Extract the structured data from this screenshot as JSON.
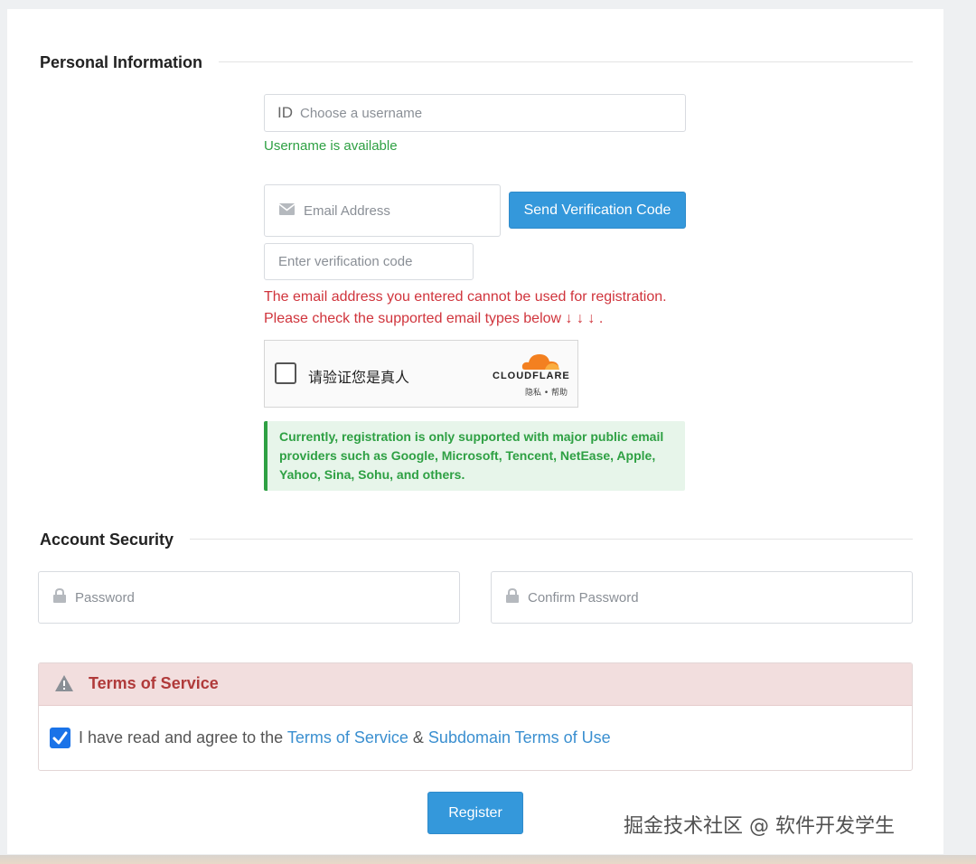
{
  "sections": {
    "personal": "Personal Information",
    "security": "Account Security"
  },
  "username": {
    "prefix": "ID",
    "placeholder": "Choose a username",
    "status": "Username is available"
  },
  "email": {
    "placeholder": "Email Address",
    "icon": "envelope-icon",
    "send_button": "Send Verification Code",
    "code_placeholder": "Enter verification code",
    "error_line1": "The email address you entered cannot be used for registration.",
    "error_line2": "Please check the supported email types below ↓ ↓ ↓ ."
  },
  "captcha": {
    "label": "请验证您是真人",
    "brand": "CLOUDFLARE",
    "links": "隐私 • 帮助"
  },
  "notice": "Currently, registration is only supported with major public email providers such as Google, Microsoft, Tencent, NetEase, Apple, Yahoo, Sina, Sohu, and others.",
  "password": {
    "placeholder": "Password",
    "confirm_placeholder": "Confirm Password",
    "icon": "lock-icon"
  },
  "terms": {
    "title": "Terms of Service",
    "agree_text": "I have read and agree to the ",
    "link1": "Terms of Service",
    "amp": " & ",
    "link2": "Subdomain Terms of Use",
    "checked": true
  },
  "register_button": "Register",
  "watermark": "掘金技术社区 @ 软件开发学生",
  "colors": {
    "primary": "#3498db",
    "success": "#2ea043",
    "danger": "#d0343c",
    "tos_header_bg": "#f2dede"
  }
}
